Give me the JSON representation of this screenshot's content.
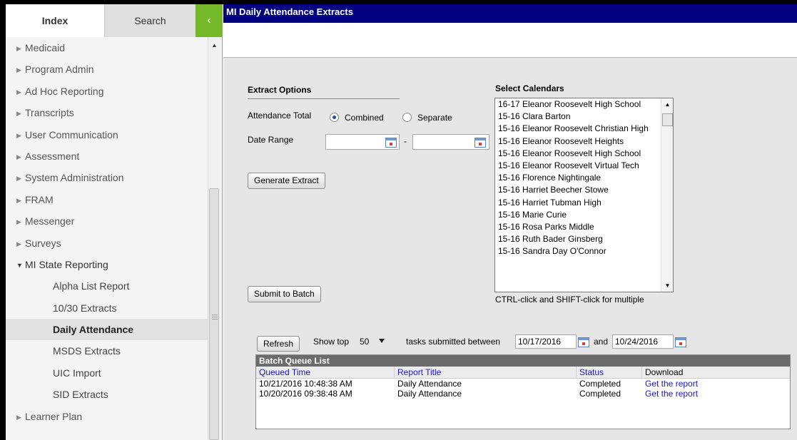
{
  "sidebar": {
    "tabs": {
      "index": "Index",
      "search": "Search",
      "collapse": "‹"
    },
    "nav": [
      {
        "label": "Medicaid"
      },
      {
        "label": "Program Admin"
      },
      {
        "label": "Ad Hoc Reporting"
      },
      {
        "label": "Transcripts"
      },
      {
        "label": "User Communication"
      },
      {
        "label": "Assessment"
      },
      {
        "label": "System Administration"
      },
      {
        "label": "FRAM"
      },
      {
        "label": "Messenger"
      },
      {
        "label": "Surveys"
      },
      {
        "label": "MI State Reporting"
      }
    ],
    "sub": [
      {
        "label": "Alpha List Report"
      },
      {
        "label": "10/30 Extracts"
      },
      {
        "label": "Daily Attendance"
      },
      {
        "label": "MSDS Extracts"
      },
      {
        "label": "UIC Import"
      },
      {
        "label": "SID Extracts"
      }
    ],
    "after": [
      {
        "label": "Learner Plan"
      }
    ]
  },
  "main": {
    "title": "MI Daily Attendance Extracts",
    "extract_options": {
      "title": "Extract Options",
      "attendance_total_label": "Attendance Total",
      "combined_label": "Combined",
      "separate_label": "Separate",
      "date_range_label": "Date Range",
      "date_separator": "-",
      "start_date_value": "",
      "end_date_value": "",
      "generate_button": "Generate Extract",
      "submit_button": "Submit to Batch"
    },
    "calendars": {
      "title": "Select Calendars",
      "items": [
        "16-17 Eleanor Roosevelt High School",
        "15-16 Clara Barton",
        "15-16 Eleanor Roosevelt Christian High",
        "15-16 Eleanor Roosevelt Heights",
        "15-16 Eleanor Roosevelt High School",
        "15-16 Eleanor Roosevelt Virtual Tech",
        "15-16 Florence Nightingale",
        "15-16 Harriet Beecher Stowe",
        "15-16 Harriet Tubman High",
        "15-16 Marie Curie",
        "15-16 Rosa Parks Middle",
        "15-16 Ruth Bader Ginsberg",
        "15-16 Sandra Day O'Connor"
      ],
      "hint": "CTRL-click and SHIFT-click for multiple"
    },
    "batch": {
      "refresh_button": "Refresh",
      "show_top_label": "Show top",
      "show_top_value": "50",
      "between_label": "tasks submitted between",
      "from_date": "10/17/2016",
      "and_label": "and",
      "to_date": "10/24/2016"
    },
    "queue": {
      "title": "Batch Queue List",
      "headers": {
        "queued_time": "Queued Time",
        "report_title": "Report Title",
        "status": "Status",
        "download": "Download"
      },
      "rows": [
        {
          "queued_time": "10/21/2016 10:48:38 AM",
          "report_title": "Daily Attendance",
          "status": "Completed",
          "download": "Get the report"
        },
        {
          "queued_time": "10/20/2016 09:38:48 AM",
          "report_title": "Daily Attendance",
          "status": "Completed",
          "download": "Get the report"
        }
      ]
    }
  }
}
